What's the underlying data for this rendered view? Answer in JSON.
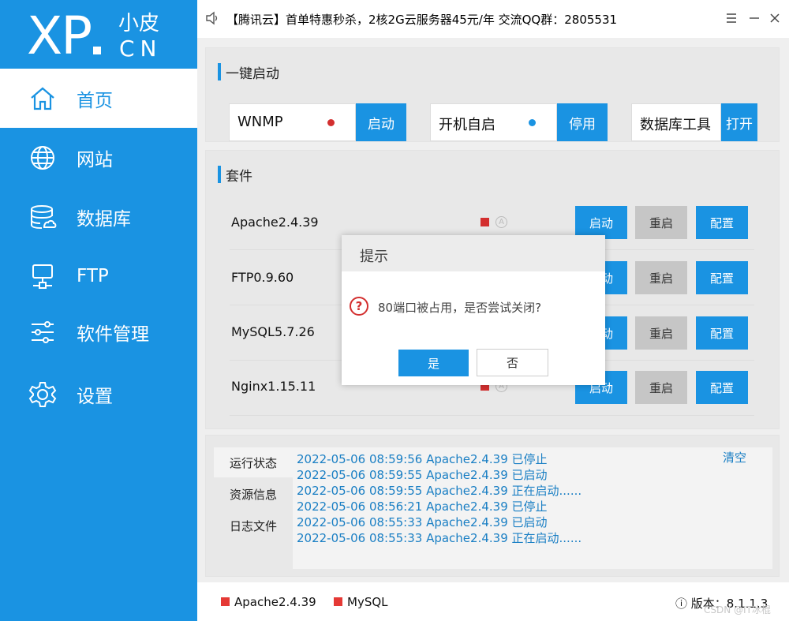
{
  "logo": {
    "main": "XP",
    "cn_top": "小皮",
    "cn_bottom": "CN"
  },
  "sidebar": {
    "items": [
      {
        "label": "首页",
        "icon": "home-icon",
        "active": true
      },
      {
        "label": "网站",
        "icon": "globe-icon"
      },
      {
        "label": "数据库",
        "icon": "database-icon"
      },
      {
        "label": "FTP",
        "icon": "ftp-icon"
      },
      {
        "label": "软件管理",
        "icon": "sliders-icon"
      },
      {
        "label": "设置",
        "icon": "gear-icon"
      }
    ]
  },
  "titlebar": {
    "announcement": "【腾讯云】首单特惠秒杀，2核2G云服务器45元/年 交流QQ群：2805531"
  },
  "quickstart": {
    "title": "一键启动",
    "items": [
      {
        "label": "WNMP",
        "dot_color": "#d32f2f",
        "button": "启动"
      },
      {
        "label": "开机自启",
        "dot_color": "#1a93e2",
        "button": "停用"
      },
      {
        "label": "数据库工具",
        "button": "打开"
      }
    ]
  },
  "suite": {
    "title": "套件",
    "rows": [
      {
        "name": "Apache2.4.39",
        "start": "启动",
        "restart": "重启",
        "config": "配置"
      },
      {
        "name": "FTP0.9.60",
        "start": "启动",
        "restart": "重启",
        "config": "配置"
      },
      {
        "name": "MySQL5.7.26",
        "start": "启动",
        "restart": "重启",
        "config": "配置"
      },
      {
        "name": "Nginx1.15.11",
        "start": "启动",
        "restart": "重启",
        "config": "配置"
      }
    ],
    "a_symbol": "A"
  },
  "log": {
    "tabs": [
      "运行状态",
      "资源信息",
      "日志文件"
    ],
    "clear": "清空",
    "lines": [
      "2022-05-06 08:59:56 Apache2.4.39 已停止",
      "2022-05-06 08:59:55 Apache2.4.39 已启动",
      "2022-05-06 08:59:55 Apache2.4.39 正在启动......",
      "2022-05-06 08:56:21 Apache2.4.39 已停止",
      "2022-05-06 08:55:33 Apache2.4.39 已启动",
      "2022-05-06 08:55:33 Apache2.4.39 正在启动......"
    ]
  },
  "statusbar": {
    "items": [
      "Apache2.4.39",
      "MySQL"
    ],
    "version": "ⓘ 版本：8.1.1.3",
    "watermark": "CSDN @IT冰棍"
  },
  "dialog": {
    "title": "提示",
    "icon_glyph": "?",
    "message": "80端口被占用，是否尝试关闭?",
    "yes": "是",
    "no": "否"
  },
  "colors": {
    "accent": "#1a93e2",
    "stopped": "#d32f2f"
  }
}
